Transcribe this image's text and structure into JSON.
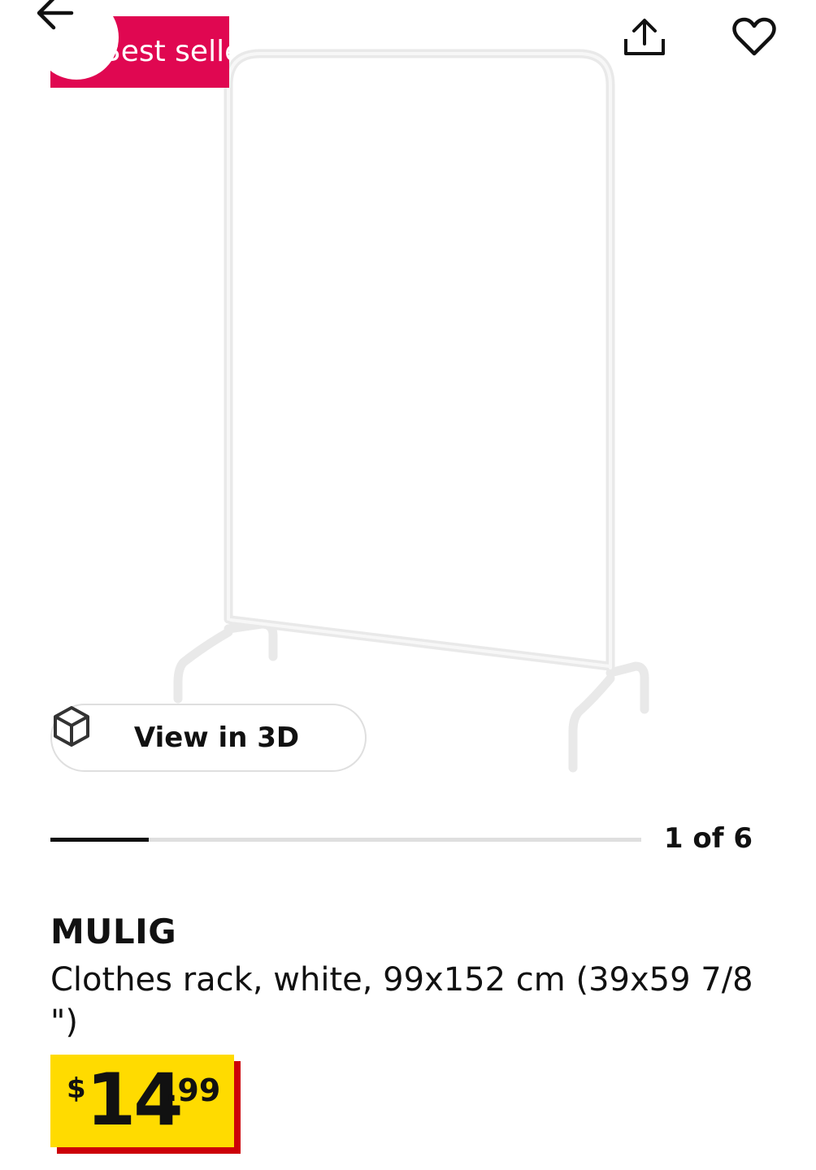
{
  "header": {
    "badge_text": "Best seller",
    "back_icon": "arrow-left-icon",
    "share_icon": "share-upload-icon",
    "favorite_icon": "heart-outline-icon"
  },
  "media": {
    "view_3d_label": "View in 3D",
    "view_3d_icon": "cube-icon",
    "counter": "1 of 6",
    "current_index": 1,
    "total": 6,
    "progress_fraction": 0.1667
  },
  "product": {
    "name": "MULIG",
    "description": "Clothes rack, white, 99x152 cm (39x59 7/8 \")",
    "price": {
      "currency": "$",
      "integer": "14",
      "decimal": ".99"
    }
  },
  "colors": {
    "badge": "#e00751",
    "price_bg": "#ffdb00",
    "price_shadow": "#cc0008"
  }
}
